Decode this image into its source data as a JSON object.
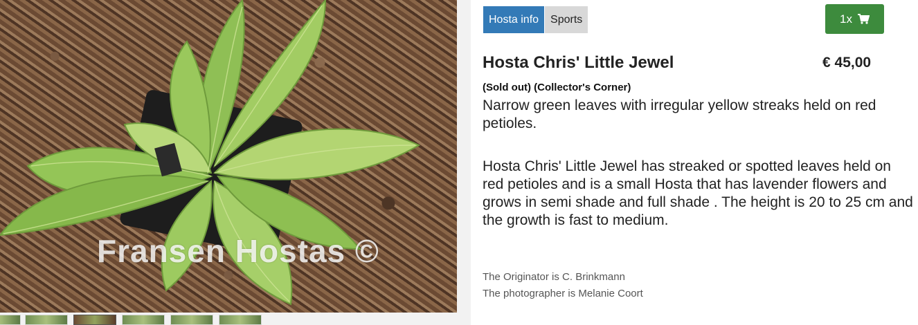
{
  "gallery": {
    "watermark": "Fransen Hostas ©",
    "thumbnails": [
      "thumb-1",
      "thumb-2",
      "thumb-3",
      "thumb-4",
      "thumb-5",
      "thumb-6"
    ],
    "active_thumbnail": 3
  },
  "tabs": [
    {
      "label": "Hosta info",
      "active": true
    },
    {
      "label": "Sports",
      "active": false
    }
  ],
  "cart": {
    "quantity_label": "1x",
    "icon": "shopping-cart-icon",
    "color": "#3d8b3d"
  },
  "product": {
    "title": "Hosta Chris' Little Jewel",
    "price": "€ 45,00",
    "status": "(Sold out) (Collector's Corner)",
    "short_description": "Narrow green leaves with irregular yellow streaks held on red petioles.",
    "long_description": "Hosta Chris' Little Jewel has streaked or spotted leaves held on red petioles and is a small Hosta that has lavender flowers and grows in semi shade and full shade . The height is 20 to 25 cm and the growth is fast to medium.",
    "originator": "The Originator is C. Brinkmann",
    "photographer": "The photographer is Melanie Coort"
  },
  "colors": {
    "tab_active": "#337ab7",
    "tab_inactive": "#d8d8d8"
  }
}
